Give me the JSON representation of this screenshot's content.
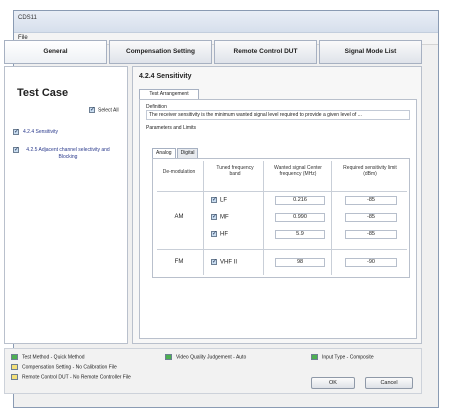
{
  "window": {
    "title": "CDS11"
  },
  "menu": {
    "file": "File"
  },
  "tabs": [
    "General",
    "Compensation Setting",
    "Remote Control DUT",
    "Signal Mode List"
  ],
  "left": {
    "heading": "Test Case",
    "select_all": "Select All",
    "items": [
      {
        "label": "4.2.4 Sensitivity"
      },
      {
        "label": "4.2.5 Adjacent channel selectivity and Blocking"
      }
    ]
  },
  "right": {
    "title": "4.2.4 Sensitivity",
    "subtab": "Test Arrangement",
    "definition_label": "Definition",
    "definition_text": "The receiver sensitivity is the minimum wanted signal level required to provide a given level of ...",
    "params_label": "Parameters and Limits",
    "inner_tabs": [
      "Analog",
      "Digital"
    ],
    "headers": {
      "demod": "De-modulation",
      "band": "Tuned frequency band",
      "freq": "Wanted signal Center frequency (MHz)",
      "level": "Required sensitivity limit (dBm)"
    },
    "rows": [
      {
        "demod": "AM",
        "band": "LF",
        "freq": "0.216",
        "level": "-85"
      },
      {
        "demod": "",
        "band": "MF",
        "freq": "0.990",
        "level": "-85"
      },
      {
        "demod": "",
        "band": "HF",
        "freq": "5.9",
        "level": "-85"
      },
      {
        "demod": "FM",
        "band": "VHF II",
        "freq": "98",
        "level": "-90"
      }
    ]
  },
  "footer": {
    "legend": [
      {
        "text": "Test Method - Quick Method",
        "color": "#4caf50"
      },
      {
        "text": "Video Quality Judgement - Auto",
        "color": "#4caf50"
      },
      {
        "text": "Input Type - Composite",
        "color": "#4caf50"
      },
      {
        "text": "Compensation Setting - No Calibration File",
        "color": "#f3e07a"
      },
      {
        "text": "Remote Control DUT - No Remote Controller File",
        "color": "#f3e07a"
      }
    ],
    "ok": "OK",
    "cancel": "Cancel"
  }
}
